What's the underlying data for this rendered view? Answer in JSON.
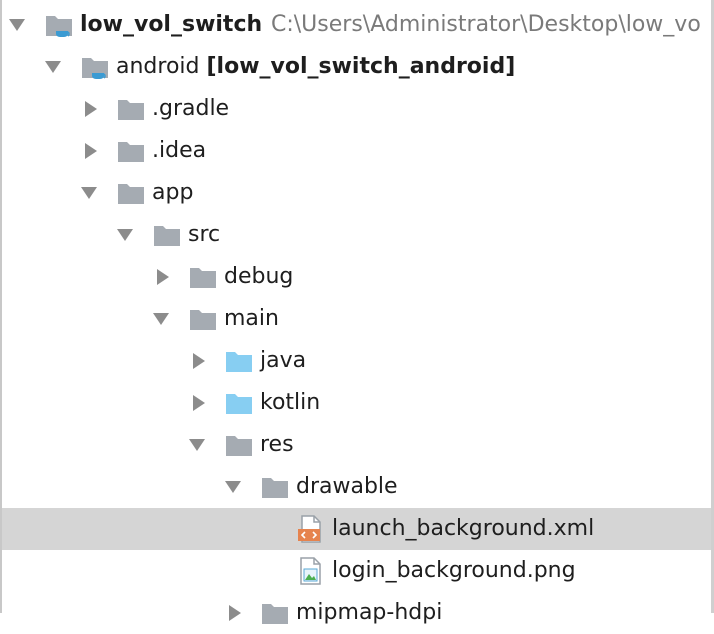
{
  "tree": {
    "rows": [
      {
        "label": "low_vol_switch",
        "path": "C:\\Users\\Administrator\\Desktop\\low_vo",
        "expanded": true,
        "icon": "module-folder-icon"
      },
      {
        "label_plain": "android ",
        "label_bold": "[low_vol_switch_android]",
        "expanded": true,
        "icon": "module-folder-icon"
      },
      {
        "label": ".gradle",
        "expanded": false,
        "icon": "folder-icon"
      },
      {
        "label": ".idea",
        "expanded": false,
        "icon": "folder-icon"
      },
      {
        "label": "app",
        "expanded": true,
        "icon": "folder-icon"
      },
      {
        "label": "src",
        "expanded": true,
        "icon": "folder-icon"
      },
      {
        "label": "debug",
        "expanded": false,
        "icon": "folder-icon"
      },
      {
        "label": "main",
        "expanded": true,
        "icon": "folder-icon"
      },
      {
        "label": "java",
        "expanded": false,
        "icon": "source-folder-icon"
      },
      {
        "label": "kotlin",
        "expanded": false,
        "icon": "source-folder-icon"
      },
      {
        "label": "res",
        "expanded": true,
        "icon": "folder-icon"
      },
      {
        "label": "drawable",
        "expanded": true,
        "icon": "folder-icon"
      },
      {
        "label": "launch_background.xml",
        "selected": true,
        "icon": "xml-file-icon"
      },
      {
        "label": "login_background.png",
        "icon": "image-file-icon"
      },
      {
        "label": "mipmap-hdpi",
        "expanded": false,
        "icon": "folder-icon"
      }
    ]
  },
  "colors": {
    "folder": "#a5abb2",
    "source_folder": "#87cef2",
    "module_badge": "#3b9bd3",
    "xml_badge": "#e6834e",
    "selection": "#d5d5d5",
    "path_text": "#7a7a7a"
  }
}
